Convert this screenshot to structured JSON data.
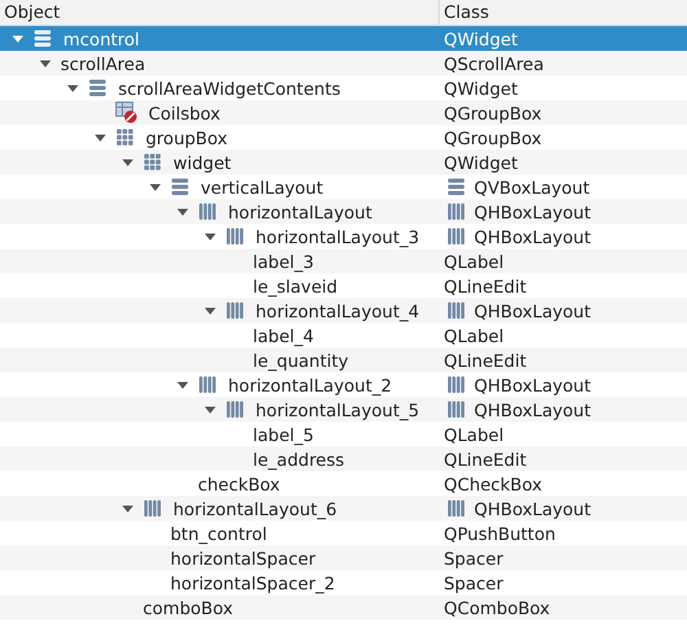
{
  "columns": [
    "Object",
    "Class"
  ],
  "tree": [
    {
      "name": "mcontrol",
      "class": "QWidget",
      "kind": "vbox",
      "selected": true,
      "expanded": true,
      "children": [
        {
          "name": "scrollArea",
          "class": "QScrollArea",
          "selected": false,
          "expanded": true,
          "children": [
            {
              "name": "scrollAreaWidgetContents",
              "class": "QWidget",
              "kind": "vbox",
              "selected": false,
              "expanded": true,
              "children": [
                {
                  "name": "Coilsbox",
                  "class": "QGroupBox",
                  "kind": "broken",
                  "selected": false
                },
                {
                  "name": "groupBox",
                  "class": "QGroupBox",
                  "kind": "grid",
                  "selected": false,
                  "expanded": true,
                  "children": [
                    {
                      "name": "widget",
                      "class": "QWidget",
                      "kind": "grid",
                      "selected": false,
                      "expanded": true,
                      "children": [
                        {
                          "name": "verticalLayout",
                          "class": "QVBoxLayout",
                          "kind": "vbox",
                          "layout": true,
                          "selected": false,
                          "expanded": true,
                          "children": [
                            {
                              "name": "horizontalLayout",
                              "class": "QHBoxLayout",
                              "kind": "hbox",
                              "layout": true,
                              "selected": false,
                              "expanded": true,
                              "children": [
                                {
                                  "name": "horizontalLayout_3",
                                  "class": "QHBoxLayout",
                                  "kind": "hbox",
                                  "layout": true,
                                  "selected": false,
                                  "expanded": true,
                                  "children": [
                                    {
                                      "name": "label_3",
                                      "class": "QLabel",
                                      "selected": false
                                    },
                                    {
                                      "name": "le_slaveid",
                                      "class": "QLineEdit",
                                      "selected": false
                                    }
                                  ]
                                },
                                {
                                  "name": "horizontalLayout_4",
                                  "class": "QHBoxLayout",
                                  "kind": "hbox",
                                  "layout": true,
                                  "selected": false,
                                  "expanded": true,
                                  "children": [
                                    {
                                      "name": "label_4",
                                      "class": "QLabel",
                                      "selected": false
                                    },
                                    {
                                      "name": "le_quantity",
                                      "class": "QLineEdit",
                                      "selected": false
                                    }
                                  ]
                                }
                              ]
                            },
                            {
                              "name": "horizontalLayout_2",
                              "class": "QHBoxLayout",
                              "kind": "hbox",
                              "layout": true,
                              "selected": false,
                              "expanded": true,
                              "children": [
                                {
                                  "name": "horizontalLayout_5",
                                  "class": "QHBoxLayout",
                                  "kind": "hbox",
                                  "layout": true,
                                  "selected": false,
                                  "expanded": true,
                                  "children": [
                                    {
                                      "name": "label_5",
                                      "class": "QLabel",
                                      "selected": false
                                    },
                                    {
                                      "name": "le_address",
                                      "class": "QLineEdit",
                                      "selected": false
                                    }
                                  ]
                                }
                              ]
                            },
                            {
                              "name": "checkBox",
                              "class": "QCheckBox",
                              "selected": false
                            }
                          ]
                        }
                      ]
                    },
                    {
                      "name": "horizontalLayout_6",
                      "class": "QHBoxLayout",
                      "kind": "hbox",
                      "layout": true,
                      "selected": false,
                      "expanded": true,
                      "children": [
                        {
                          "name": "btn_control",
                          "class": "QPushButton",
                          "selected": false
                        },
                        {
                          "name": "horizontalSpacer",
                          "class": "Spacer",
                          "selected": false
                        },
                        {
                          "name": "horizontalSpacer_2",
                          "class": "Spacer",
                          "selected": false
                        }
                      ]
                    },
                    {
                      "name": "comboBox",
                      "class": "QComboBox",
                      "selected": false
                    }
                  ]
                }
              ]
            }
          ]
        }
      ]
    }
  ]
}
